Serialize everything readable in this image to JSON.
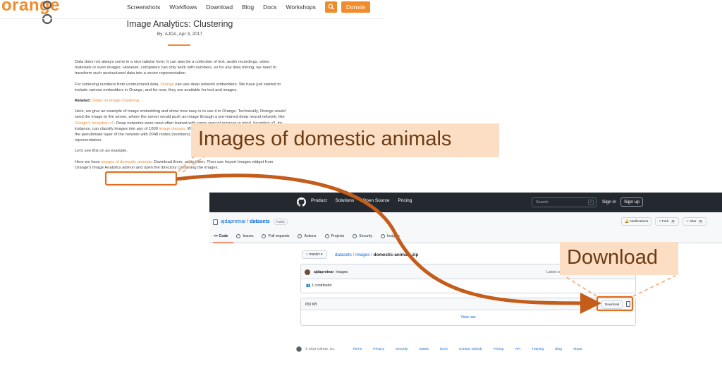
{
  "site": {
    "logo_text": "orange",
    "nav": [
      "Screenshots",
      "Workflows",
      "Download",
      "Blog",
      "Docs",
      "Workshops"
    ],
    "donate_label": "Donate"
  },
  "post": {
    "title": "Image Analytics: Clustering",
    "byline": "By: AJDA, Apr 3, 2017",
    "p1": "Data does not always come in a nice tabular form. It can also be a collection of text, audio recordings, video materials or even images. However, computers can only work with numbers, so for any data mining, we need to transform such unstructured data into a vector representation.",
    "p2_a": "For retrieving numbers from unstructured data, ",
    "p2_link": "Orange",
    "p2_b": " can use deep network embedders. We have just started to include various embedders in Orange, and for now, they are available for text and images.",
    "related_label": "Related:",
    "related_link": "Video on image clustering",
    "p3_a": "Here, we give an example of image embedding and show how easy is to use it in Orange. Technically, Orange would send the image to the server, where the server would push an image through a pre-trained deep neural network, like ",
    "p3_link1": "Google's Inception v3",
    "p3_b": ". Deep networks were most often trained with some special purpose in mind. Inception v3, for instance, can classify images into any of 1000 ",
    "p3_link2": "image classes",
    "p3_c": ". We can disregard the classification, consider instead the penultimate layer of the network with 2048 nodes (numbers) and use that for image's vector-based representation.",
    "p4": "Let's see this on an example.",
    "p5_a": "Here we have ",
    "p5_link": "images of domestic animals",
    "p5_b": ". Download them, unzip them. Then use Import Images widget from Orange's Image Analytics add-on and open the directory containing the images."
  },
  "github": {
    "menu": [
      "Product",
      "Solutions",
      "Open Source",
      "Pricing"
    ],
    "search_placeholder": "Search",
    "slash_key": "/",
    "signin": "Sign in",
    "signup": "Sign up",
    "owner": "ajdapretnar",
    "separator": " / ",
    "repo": "datasets",
    "visibility": "Public",
    "notifications": "Notifications",
    "fork_label": "Fork",
    "fork_count": "8",
    "star_label": "Star",
    "star_count": "5",
    "tabs": [
      "Code",
      "Issues",
      "Pull requests",
      "Actions",
      "Projects",
      "Security",
      "Insights"
    ],
    "branch": "master",
    "path_1": "datasets",
    "path_2": "images",
    "path_file": "domestic-animals.zip",
    "commit_author": "ajdapretnar",
    "commit_msg": "Images",
    "latest_commit": "Latest commit",
    "contributors": "1 contributor",
    "file_size": "653 KB",
    "download": "Download",
    "view_raw": "View raw",
    "footer_copy": "© 2022 GitHub, Inc.",
    "footer_links": [
      "Terms",
      "Privacy",
      "Security",
      "Status",
      "Docs",
      "Contact GitHub",
      "Pricing",
      "API",
      "Training",
      "Blog",
      "About"
    ]
  },
  "callouts": {
    "animals": "Images of domestic animals",
    "download": "Download"
  },
  "colors": {
    "orange_brand": "#f08c2c",
    "callout_fill": "#fbdec4",
    "arrow": "#c45c1a",
    "github_dark": "#24292f",
    "github_link": "#0969da"
  }
}
